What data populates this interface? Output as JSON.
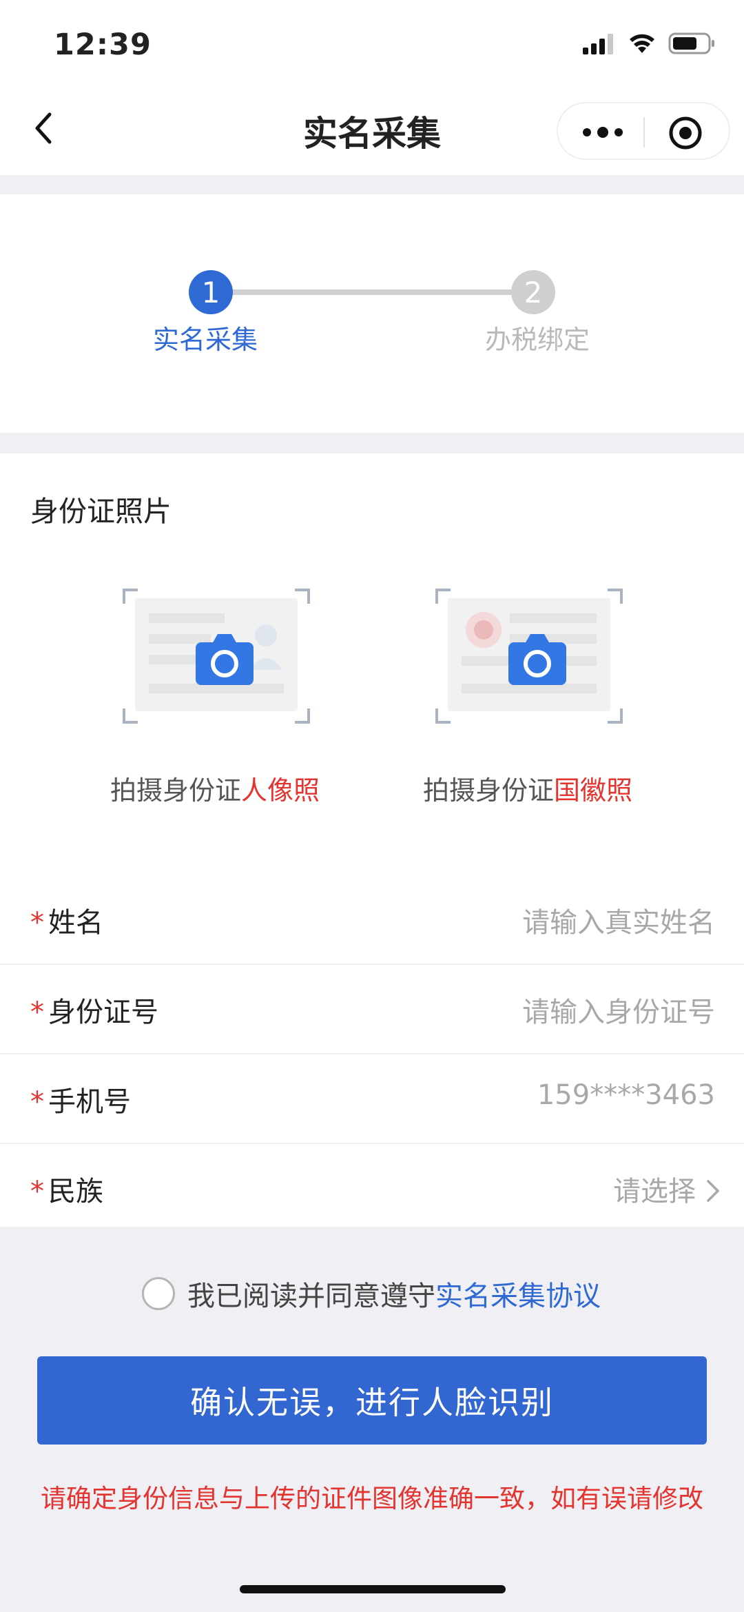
{
  "status_bar": {
    "time": "12:39"
  },
  "nav": {
    "title": "实名采集"
  },
  "steps": [
    {
      "number": "1",
      "label": "实名采集"
    },
    {
      "number": "2",
      "label": "办税绑定"
    }
  ],
  "id_photos": {
    "section_title": "身份证照片",
    "front": {
      "caption_prefix": "拍摄身份证",
      "caption_highlight": "人像照"
    },
    "back": {
      "caption_prefix": "拍摄身份证",
      "caption_highlight": "国徽照"
    }
  },
  "form": {
    "required_mark": "*",
    "fields": [
      {
        "label": "姓名",
        "placeholder": "请输入真实姓名"
      },
      {
        "label": "身份证号",
        "placeholder": "请输入身份证号"
      },
      {
        "label": "手机号",
        "value": "159****3463"
      },
      {
        "label": "民族",
        "placeholder": "请选择"
      }
    ]
  },
  "agreement": {
    "text": "我已阅读并同意遵守",
    "link": "实名采集协议"
  },
  "confirm_button": "确认无误，进行人脸识别",
  "warning": "请确定身份信息与上传的证件图像准确一致，如有误请修改",
  "colors": {
    "primary": "#3267d1",
    "alert": "#e3342f"
  }
}
